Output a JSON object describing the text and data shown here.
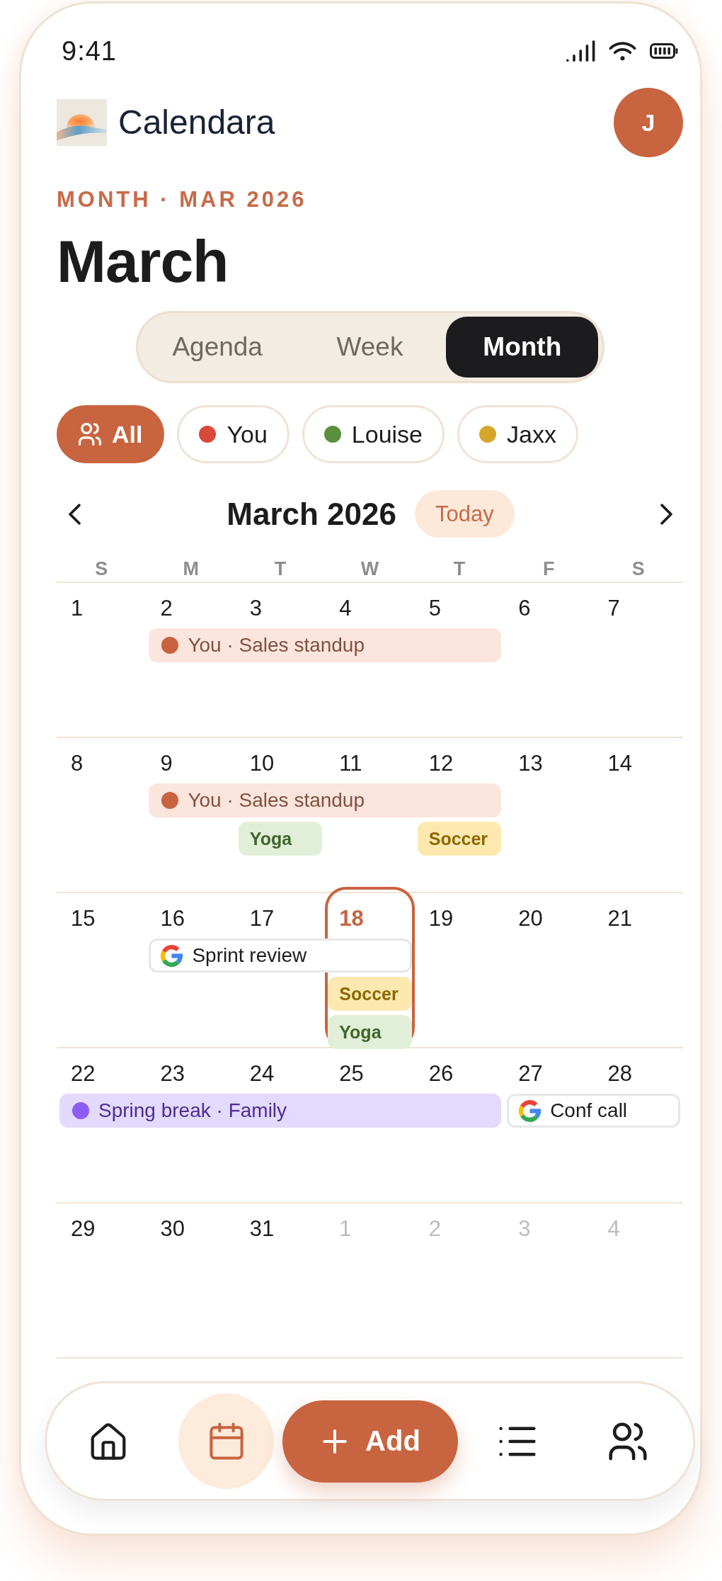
{
  "status_bar": {
    "time": "9:41"
  },
  "header": {
    "app_name": "Calendara",
    "avatar_initial": "J"
  },
  "heading": {
    "eyebrow": "MONTH · MAR 2026",
    "title": "March"
  },
  "view_tabs": [
    {
      "label": "Agenda",
      "selected": false
    },
    {
      "label": "Week",
      "selected": false
    },
    {
      "label": "Month",
      "selected": true
    }
  ],
  "filters": [
    {
      "kind": "all",
      "label": "All",
      "selected": true
    },
    {
      "kind": "person",
      "label": "You",
      "color": "#d9483b",
      "selected": false
    },
    {
      "kind": "person",
      "label": "Louise",
      "color": "#5a8f3c",
      "selected": false
    },
    {
      "kind": "person",
      "label": "Jaxx",
      "color": "#d4a72c",
      "selected": false
    }
  ],
  "month_nav": {
    "title": "March 2026",
    "today_button": "Today"
  },
  "weekdays": [
    "S",
    "M",
    "T",
    "W",
    "T",
    "F",
    "S"
  ],
  "weeks": [
    {
      "cells": [
        {
          "kind": "day",
          "label": "1",
          "outside": false,
          "today": false
        },
        {
          "kind": "span",
          "event": {
            "kind": "bar",
            "title": "You · Sales standup",
            "color": "#c9633f"
          },
          "days": [
            {
              "kind": "day",
              "label": "2",
              "outside": false,
              "today": false
            },
            {
              "kind": "day",
              "label": "3",
              "outside": false,
              "today": false
            },
            {
              "kind": "day",
              "label": "4",
              "outside": false,
              "today": false
            },
            {
              "kind": "day",
              "label": "5",
              "outside": false,
              "today": false
            }
          ]
        },
        {
          "kind": "day",
          "label": "6",
          "outside": false,
          "today": false
        },
        {
          "kind": "day",
          "label": "7",
          "outside": false,
          "today": false
        }
      ]
    },
    {
      "cells": [
        {
          "kind": "day",
          "label": "8",
          "outside": false,
          "today": false
        },
        {
          "kind": "span",
          "event": {
            "kind": "bar",
            "title": "You · Sales standup",
            "color": "#c9633f"
          },
          "days": [
            {
              "kind": "day",
              "label": "9",
              "outside": false,
              "today": false
            },
            {
              "kind": "day",
              "label": "10",
              "outside": false,
              "today": false,
              "events": [
                {
                  "kind": "tag",
                  "title": "Yoga",
                  "color": "#e1efd8"
                }
              ]
            },
            {
              "kind": "day",
              "label": "11",
              "outside": false,
              "today": false
            },
            {
              "kind": "day",
              "label": "12",
              "outside": false,
              "today": false,
              "events": [
                {
                  "kind": "tag",
                  "title": "Soccer",
                  "color": "#fde9b0"
                }
              ]
            }
          ]
        },
        {
          "kind": "day",
          "label": "13",
          "outside": false,
          "today": false
        },
        {
          "kind": "day",
          "label": "14",
          "outside": false,
          "today": false
        }
      ]
    },
    {
      "cells": [
        {
          "kind": "day",
          "label": "15",
          "outside": false,
          "today": false
        },
        {
          "kind": "span",
          "event": {
            "kind": "google",
            "title": "Sprint review"
          },
          "days": [
            {
              "kind": "day",
              "label": "16",
              "outside": false,
              "today": false
            },
            {
              "kind": "day",
              "label": "17",
              "outside": false,
              "today": false
            },
            {
              "kind": "day",
              "label": "18",
              "outside": false,
              "today": true,
              "events": [
                {
                  "kind": "tag",
                  "title": "Soccer",
                  "color": "#fde9b0"
                },
                {
                  "kind": "tag",
                  "title": "Yoga",
                  "color": "#e1efd8"
                }
              ]
            }
          ]
        },
        {
          "kind": "day",
          "label": "19",
          "outside": false,
          "today": false
        },
        {
          "kind": "day",
          "label": "20",
          "outside": false,
          "today": false
        },
        {
          "kind": "day",
          "label": "21",
          "outside": false,
          "today": false
        }
      ]
    },
    {
      "cells": [
        {
          "kind": "span",
          "event": {
            "kind": "bar",
            "title": "Spring break · Family",
            "color": "#8b5cf6"
          },
          "days": [
            {
              "kind": "day",
              "label": "22",
              "outside": false,
              "today": false
            },
            {
              "kind": "day",
              "label": "23",
              "outside": false,
              "today": false
            },
            {
              "kind": "day",
              "label": "24",
              "outside": false,
              "today": false
            },
            {
              "kind": "day",
              "label": "25",
              "outside": false,
              "today": false
            },
            {
              "kind": "day",
              "label": "26",
              "outside": false,
              "today": false
            }
          ]
        },
        {
          "kind": "span",
          "event": {
            "kind": "google",
            "title": "Conf call"
          },
          "days": [
            {
              "kind": "day",
              "label": "27",
              "outside": false,
              "today": false
            },
            {
              "kind": "day",
              "label": "28",
              "outside": false,
              "today": false
            }
          ]
        }
      ]
    },
    {
      "cells": [
        {
          "kind": "day",
          "label": "29",
          "outside": false,
          "today": false
        },
        {
          "kind": "day",
          "label": "30",
          "outside": false,
          "today": false
        },
        {
          "kind": "day",
          "label": "31",
          "outside": false,
          "today": false
        },
        {
          "kind": "day",
          "label": "1",
          "outside": true,
          "today": false
        },
        {
          "kind": "day",
          "label": "2",
          "outside": true,
          "today": false
        },
        {
          "kind": "day",
          "label": "3",
          "outside": true,
          "today": false
        },
        {
          "kind": "day",
          "label": "4",
          "outside": true,
          "today": false
        }
      ]
    }
  ],
  "bottom_nav": [
    {
      "kind": "home",
      "selected": false
    },
    {
      "kind": "calendar",
      "selected": true
    },
    {
      "kind": "add",
      "label": "Add",
      "selected": false
    },
    {
      "kind": "list",
      "selected": false
    },
    {
      "kind": "people",
      "selected": false
    }
  ]
}
